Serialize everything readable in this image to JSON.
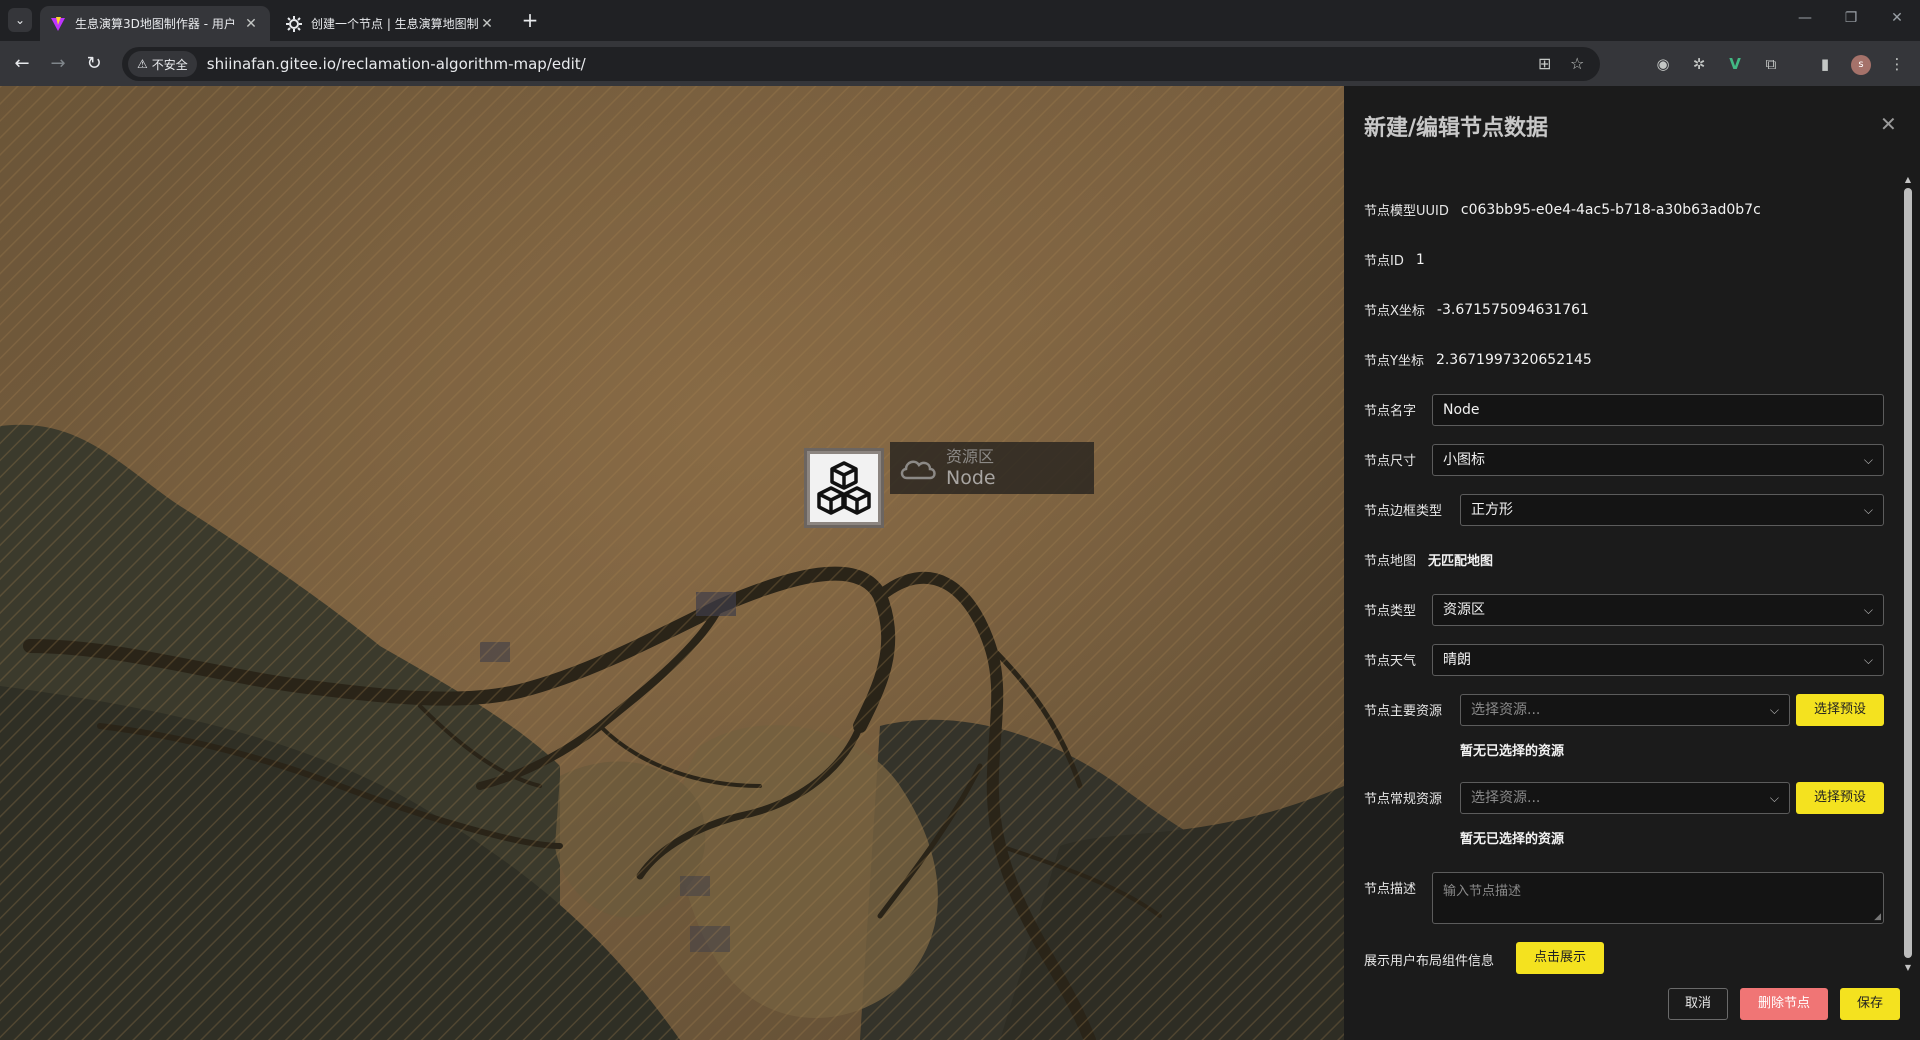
{
  "browser": {
    "tabs": [
      {
        "title": "生息演算3D地图制作器 - 用户",
        "active": true
      },
      {
        "title": "创建一个节点 | 生息演算地图制",
        "active": false
      }
    ],
    "security_label": "不安全",
    "url": "shiinafan.gitee.io/reclamation-algorithm-map/edit/",
    "profile_initial": "s"
  },
  "map": {
    "node": {
      "type_label": "资源区",
      "name": "Node"
    }
  },
  "panel": {
    "title": "新建/编辑节点数据",
    "fields": {
      "uuid_label": "节点模型UUID",
      "uuid_value": "c063bb95-e0e4-4ac5-b718-a30b63ad0b7c",
      "id_label": "节点ID",
      "id_value": "1",
      "x_label": "节点X坐标",
      "x_value": "-3.671575094631761",
      "y_label": "节点Y坐标",
      "y_value": "2.3671997320652145",
      "name_label": "节点名字",
      "name_value": "Node",
      "size_label": "节点尺寸",
      "size_value": "小图标",
      "border_label": "节点边框类型",
      "border_value": "正方形",
      "map_label": "节点地图",
      "map_value": "无匹配地图",
      "type_label": "节点类型",
      "type_value": "资源区",
      "weather_label": "节点天气",
      "weather_value": "晴朗",
      "main_res_label": "节点主要资源",
      "main_res_placeholder": "选择资源...",
      "main_res_empty": "暂无已选择的资源",
      "normal_res_label": "节点常规资源",
      "normal_res_placeholder": "选择资源...",
      "normal_res_empty": "暂无已选择的资源",
      "desc_label": "节点描述",
      "desc_placeholder": "输入节点描述",
      "layout_info_label": "展示用户布局组件信息"
    },
    "buttons": {
      "preset_main": "选择预设",
      "preset_normal": "选择预设",
      "show": "点击展示",
      "cancel": "取消",
      "delete": "删除节点",
      "save": "保存"
    }
  },
  "colors": {
    "accent_yellow": "#f4e21f",
    "danger_red": "#f07575",
    "panel_bg": "#1b1b1b"
  }
}
